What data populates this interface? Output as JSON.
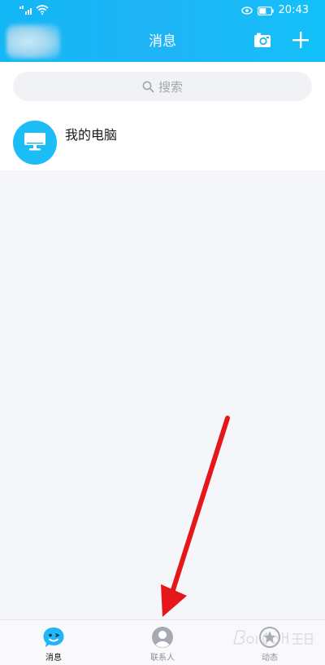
{
  "status_bar": {
    "time": "20:43"
  },
  "header": {
    "title": "消息"
  },
  "search": {
    "placeholder": "搜索"
  },
  "conversations": [
    {
      "name": "我的电脑",
      "icon": "monitor-icon"
    }
  ],
  "tabs": [
    {
      "label": "消息",
      "icon": "chat-bubble-icon",
      "active": true
    },
    {
      "label": "联系人",
      "icon": "contact-person-icon",
      "active": false
    },
    {
      "label": "动态",
      "icon": "star-feed-icon",
      "active": false
    }
  ],
  "colors": {
    "accent": "#12b7f5",
    "annotation": "#e5171b",
    "background": "#f5f6fa"
  }
}
